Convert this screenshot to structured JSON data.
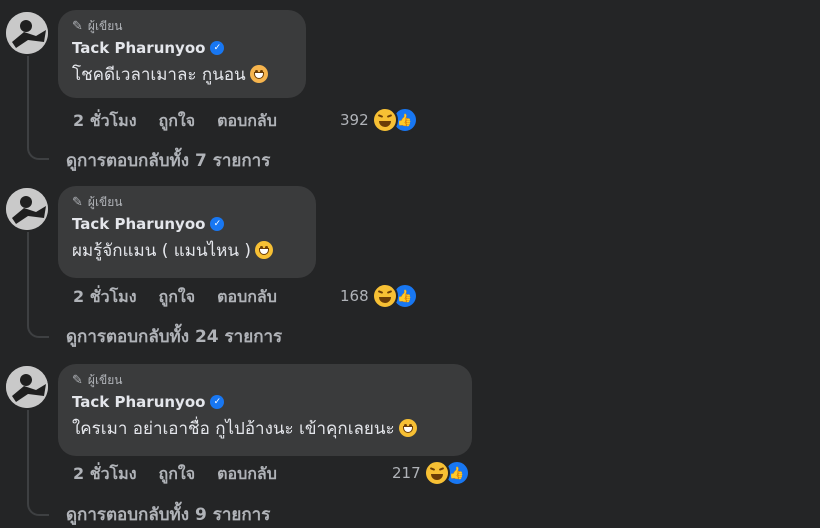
{
  "comments": [
    {
      "badge": "ผู้เขียน",
      "author": "Tack Pharunyoo",
      "text": "โชคดีเวลาเมาละ กูนอน",
      "emoji": "dizzy-face",
      "time": "2 ชั่วโมง",
      "like_label": "ถูกใจ",
      "reply_label": "ตอบกลับ",
      "reaction_count": "392",
      "view_replies": "ดูการตอบกลับทั้ง 7 รายการ"
    },
    {
      "badge": "ผู้เขียน",
      "author": "Tack Pharunyoo",
      "text": "ผมรู้จักแมน ( แมนไหน )",
      "emoji": "grimacing-face",
      "time": "2 ชั่วโมง",
      "like_label": "ถูกใจ",
      "reply_label": "ตอบกลับ",
      "reaction_count": "168",
      "view_replies": "ดูการตอบกลับทั้ง 24 รายการ"
    },
    {
      "badge": "ผู้เขียน",
      "author": "Tack Pharunyoo",
      "text": "ใครเมา อย่าเอาชื่อ กูไปอ้างนะ เข้าคุกเลยนะ",
      "emoji": "grimacing-face",
      "time": "2 ชั่วโมง",
      "like_label": "ถูกใจ",
      "reply_label": "ตอบกลับ",
      "reaction_count": "217",
      "view_replies": "ดูการตอบกลับทั้ง 9 รายการ"
    }
  ],
  "colors": {
    "background": "#242526",
    "bubble": "#3a3b3c",
    "verified": "#1877f2",
    "secondary_text": "#b0b3b8"
  }
}
